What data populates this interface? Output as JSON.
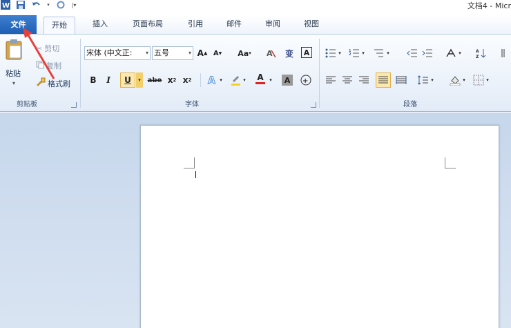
{
  "titlebar": {
    "doc_title": "文档4 - Micr"
  },
  "tabs": [
    {
      "label": "文件"
    },
    {
      "label": "开始"
    },
    {
      "label": "插入"
    },
    {
      "label": "页面布局"
    },
    {
      "label": "引用"
    },
    {
      "label": "邮件"
    },
    {
      "label": "审阅"
    },
    {
      "label": "视图"
    }
  ],
  "clipboard": {
    "paste_label": "粘贴",
    "cut_label": "剪切",
    "copy_label": "复制",
    "format_painter_label": "格式刷",
    "group_label": "剪贴板"
  },
  "font": {
    "font_name": "宋体 (中文正:",
    "font_size": "五号",
    "group_label": "字体",
    "grow_label": "A",
    "shrink_label": "A",
    "case_label": "Aa",
    "bold": "B",
    "italic": "I",
    "underline": "U",
    "strike": "abe",
    "subscript": "x",
    "superscript": "x",
    "phonetic": "变",
    "border_char": "A",
    "font_color": "A",
    "shading_char": "A",
    "enclose_char": "字"
  },
  "paragraph": {
    "group_label": "段落"
  },
  "colors": {
    "file_tab": "#2a67b9",
    "highlight_yellow": "#f5d21f",
    "font_color_red": "#e02020",
    "arrow_red": "#e8403a"
  }
}
